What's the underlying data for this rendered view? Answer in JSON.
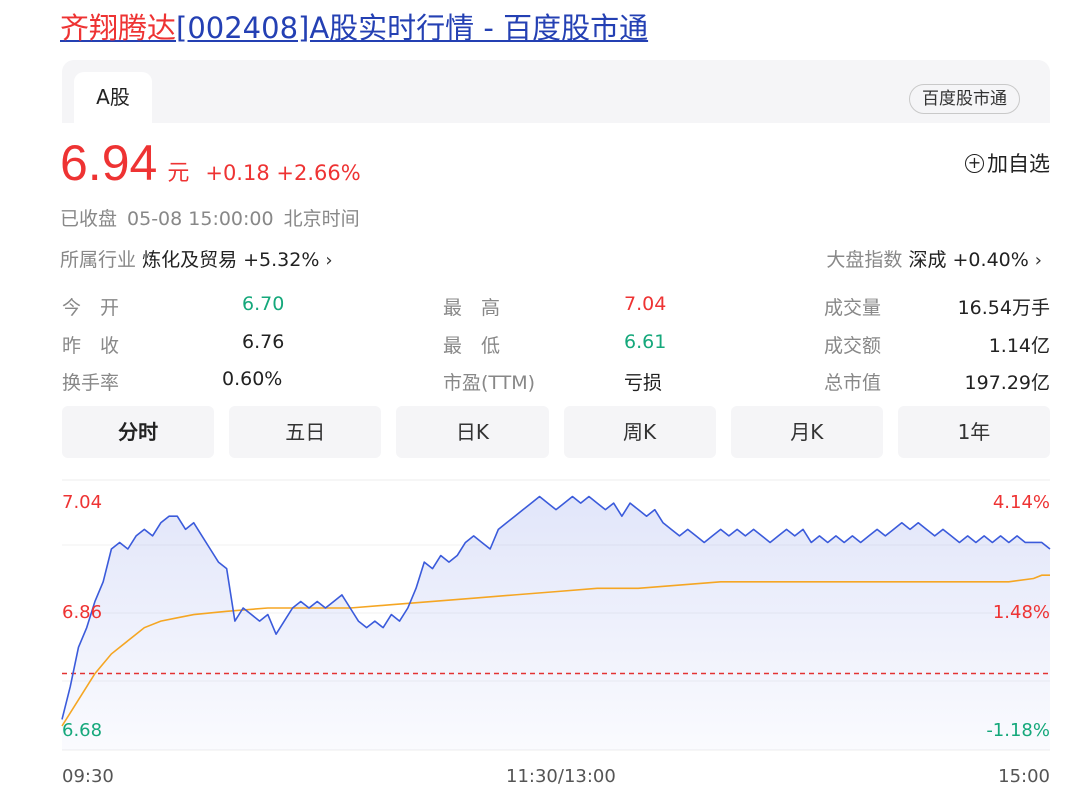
{
  "page": {
    "title_highlight": "齐翔腾达",
    "title_rest": "[002408]A股实时行情 - 百度股市通"
  },
  "tabs": {
    "active": "A股",
    "source": "百度股市通"
  },
  "quote": {
    "price": "6.94",
    "unit": "元",
    "change": "+0.18",
    "change_pct": "+2.66%",
    "add_watch_label": "加自选",
    "status": "已收盘",
    "datetime": "05-08 15:00:00",
    "timezone": "北京时间"
  },
  "industry": {
    "label": "所属行业",
    "name": "炼化及贸易",
    "pct": "+5.32%"
  },
  "index": {
    "label": "大盘指数",
    "name": "深成",
    "pct": "+0.40%"
  },
  "stats": {
    "open_label": "今　开",
    "open": "6.70",
    "prev_label": "昨　收",
    "prev": "6.76",
    "turnover_label": "换手率",
    "turnover": "0.60%",
    "high_label": "最　高",
    "high": "7.04",
    "low_label": "最　低",
    "low": "6.61",
    "pe_label": "市盈(TTM)",
    "pe": "亏损",
    "vol_label": "成交量",
    "vol": "16.54万手",
    "amount_label": "成交额",
    "amount": "1.14亿",
    "mcap_label": "总市值",
    "mcap": "197.29亿"
  },
  "periods": [
    "分时",
    "五日",
    "日K",
    "周K",
    "月K",
    "1年"
  ],
  "colors": {
    "up": "#e33333",
    "down": "#15a87b",
    "price_line": "#3b5bdb",
    "avg_line": "#f5a623",
    "link": "#2440b3"
  },
  "chart_data": {
    "type": "line",
    "ylim": [
      6.68,
      7.04
    ],
    "y_ticks": [
      "7.04",
      "6.86",
      "6.68"
    ],
    "y_pct_ticks": [
      "4.14%",
      "1.48%",
      "-1.18%"
    ],
    "prev_close": 6.76,
    "x_ticks": [
      "09:30",
      "11:30/13:00",
      "15:00"
    ],
    "x_range": [
      0,
      240
    ],
    "series": [
      {
        "values": [
          [
            0,
            6.69
          ],
          [
            2,
            6.74
          ],
          [
            4,
            6.8
          ],
          [
            6,
            6.83
          ],
          [
            8,
            6.87
          ],
          [
            10,
            6.9
          ],
          [
            12,
            6.95
          ],
          [
            14,
            6.96
          ],
          [
            16,
            6.95
          ],
          [
            18,
            6.97
          ],
          [
            20,
            6.98
          ],
          [
            22,
            6.97
          ],
          [
            24,
            6.99
          ],
          [
            26,
            7.0
          ],
          [
            28,
            7.0
          ],
          [
            30,
            6.98
          ],
          [
            32,
            6.99
          ],
          [
            34,
            6.97
          ],
          [
            36,
            6.95
          ],
          [
            38,
            6.93
          ],
          [
            40,
            6.92
          ],
          [
            42,
            6.84
          ],
          [
            44,
            6.86
          ],
          [
            46,
            6.85
          ],
          [
            48,
            6.84
          ],
          [
            50,
            6.85
          ],
          [
            52,
            6.82
          ],
          [
            54,
            6.84
          ],
          [
            56,
            6.86
          ],
          [
            58,
            6.87
          ],
          [
            60,
            6.86
          ],
          [
            62,
            6.87
          ],
          [
            64,
            6.86
          ],
          [
            66,
            6.87
          ],
          [
            68,
            6.88
          ],
          [
            70,
            6.86
          ],
          [
            72,
            6.84
          ],
          [
            74,
            6.83
          ],
          [
            76,
            6.84
          ],
          [
            78,
            6.83
          ],
          [
            80,
            6.85
          ],
          [
            82,
            6.84
          ],
          [
            84,
            6.86
          ],
          [
            86,
            6.89
          ],
          [
            88,
            6.93
          ],
          [
            90,
            6.92
          ],
          [
            92,
            6.94
          ],
          [
            94,
            6.93
          ],
          [
            96,
            6.94
          ],
          [
            98,
            6.96
          ],
          [
            100,
            6.97
          ],
          [
            102,
            6.96
          ],
          [
            104,
            6.95
          ],
          [
            106,
            6.98
          ],
          [
            108,
            6.99
          ],
          [
            110,
            7.0
          ],
          [
            112,
            7.01
          ],
          [
            114,
            7.02
          ],
          [
            116,
            7.03
          ],
          [
            118,
            7.02
          ],
          [
            120,
            7.01
          ],
          [
            122,
            7.02
          ],
          [
            124,
            7.03
          ],
          [
            126,
            7.02
          ],
          [
            128,
            7.03
          ],
          [
            130,
            7.02
          ],
          [
            132,
            7.01
          ],
          [
            134,
            7.02
          ],
          [
            136,
            7.0
          ],
          [
            138,
            7.02
          ],
          [
            140,
            7.01
          ],
          [
            142,
            7.0
          ],
          [
            144,
            7.01
          ],
          [
            146,
            6.99
          ],
          [
            148,
            6.98
          ],
          [
            150,
            6.97
          ],
          [
            152,
            6.98
          ],
          [
            154,
            6.97
          ],
          [
            156,
            6.96
          ],
          [
            158,
            6.97
          ],
          [
            160,
            6.98
          ],
          [
            162,
            6.97
          ],
          [
            164,
            6.98
          ],
          [
            166,
            6.97
          ],
          [
            168,
            6.98
          ],
          [
            170,
            6.97
          ],
          [
            172,
            6.96
          ],
          [
            174,
            6.97
          ],
          [
            176,
            6.98
          ],
          [
            178,
            6.97
          ],
          [
            180,
            6.98
          ],
          [
            182,
            6.96
          ],
          [
            184,
            6.97
          ],
          [
            186,
            6.96
          ],
          [
            188,
            6.97
          ],
          [
            190,
            6.96
          ],
          [
            192,
            6.97
          ],
          [
            194,
            6.96
          ],
          [
            196,
            6.97
          ],
          [
            198,
            6.98
          ],
          [
            200,
            6.97
          ],
          [
            202,
            6.98
          ],
          [
            204,
            6.99
          ],
          [
            206,
            6.98
          ],
          [
            208,
            6.99
          ],
          [
            210,
            6.98
          ],
          [
            212,
            6.97
          ],
          [
            214,
            6.98
          ],
          [
            216,
            6.97
          ],
          [
            218,
            6.96
          ],
          [
            220,
            6.97
          ],
          [
            222,
            6.96
          ],
          [
            224,
            6.97
          ],
          [
            226,
            6.96
          ],
          [
            228,
            6.97
          ],
          [
            230,
            6.96
          ],
          [
            232,
            6.97
          ],
          [
            234,
            6.96
          ],
          [
            236,
            6.96
          ],
          [
            238,
            6.96
          ],
          [
            240,
            6.95
          ]
        ]
      },
      {
        "values": [
          [
            0,
            6.68
          ],
          [
            4,
            6.72
          ],
          [
            8,
            6.76
          ],
          [
            12,
            6.79
          ],
          [
            16,
            6.81
          ],
          [
            20,
            6.83
          ],
          [
            24,
            6.84
          ],
          [
            28,
            6.845
          ],
          [
            32,
            6.85
          ],
          [
            40,
            6.855
          ],
          [
            50,
            6.86
          ],
          [
            60,
            6.86
          ],
          [
            70,
            6.86
          ],
          [
            80,
            6.865
          ],
          [
            90,
            6.87
          ],
          [
            100,
            6.875
          ],
          [
            110,
            6.88
          ],
          [
            120,
            6.885
          ],
          [
            130,
            6.89
          ],
          [
            140,
            6.89
          ],
          [
            150,
            6.895
          ],
          [
            160,
            6.9
          ],
          [
            170,
            6.9
          ],
          [
            180,
            6.9
          ],
          [
            190,
            6.9
          ],
          [
            200,
            6.9
          ],
          [
            210,
            6.9
          ],
          [
            220,
            6.9
          ],
          [
            230,
            6.9
          ],
          [
            236,
            6.905
          ],
          [
            238,
            6.91
          ],
          [
            240,
            6.91
          ]
        ]
      }
    ]
  }
}
